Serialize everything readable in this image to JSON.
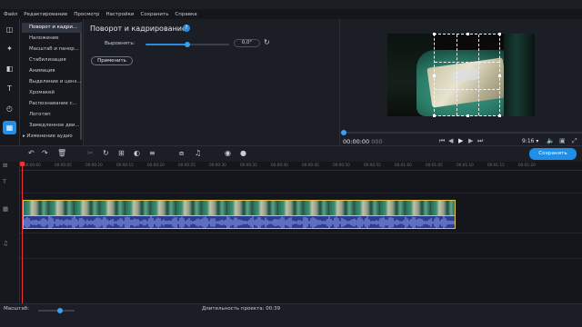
{
  "menu": [
    "Файл",
    "Редактирование",
    "Просмотр",
    "Настройки",
    "Сохранить",
    "Справка"
  ],
  "rail_icons": [
    "import-icon",
    "magic-wand-icon",
    "transitions-icon",
    "titles-icon",
    "stickers-icon",
    "effects-grid-icon"
  ],
  "effects_list": [
    {
      "label": "Поворот и кадри...",
      "selected": true
    },
    {
      "label": "Наложение"
    },
    {
      "label": "Масштаб и панор..."
    },
    {
      "label": "Стабилизация"
    },
    {
      "label": "Анимация"
    },
    {
      "label": "Выделение и ценз..."
    },
    {
      "label": "Хромакей"
    },
    {
      "label": "Распознавание с..."
    },
    {
      "label": "Логотип"
    },
    {
      "label": "Замедленное дви..."
    },
    {
      "label": "Изменение аудио",
      "has_arrow": true
    }
  ],
  "settings": {
    "title": "Поворот и кадрирование",
    "align_label": "Выровнять:",
    "align_value": "0,0°",
    "align_slider_fraction": 0.5,
    "apply_label": "Применить"
  },
  "preview": {
    "time_current": "00:00:00",
    "time_frames": "000",
    "aspect_ratio": "9:16",
    "scrub_fraction": 0.0
  },
  "toolbar": {
    "save_label": "Сохранить"
  },
  "ruler_ticks": [
    "00:00:00",
    "00:00:05",
    "00:00:10",
    "00:00:15",
    "00:00:20",
    "00:00:25",
    "00:00:30",
    "00:00:35",
    "00:00:40",
    "00:00:45",
    "00:00:50",
    "00:00:55",
    "00:01:00",
    "00:01:05",
    "00:01:10",
    "00:01:15",
    "00:01:20"
  ],
  "statusbar": {
    "zoom_label": "Масштаб:",
    "zoom_fraction": 0.6,
    "duration_label": "Длительность проекта: 00:39"
  },
  "colors": {
    "accent": "#1f8fe8",
    "playhead": "#e33333",
    "clip_border": "#e0c34a",
    "audio_clip": "#2f3b8f"
  }
}
